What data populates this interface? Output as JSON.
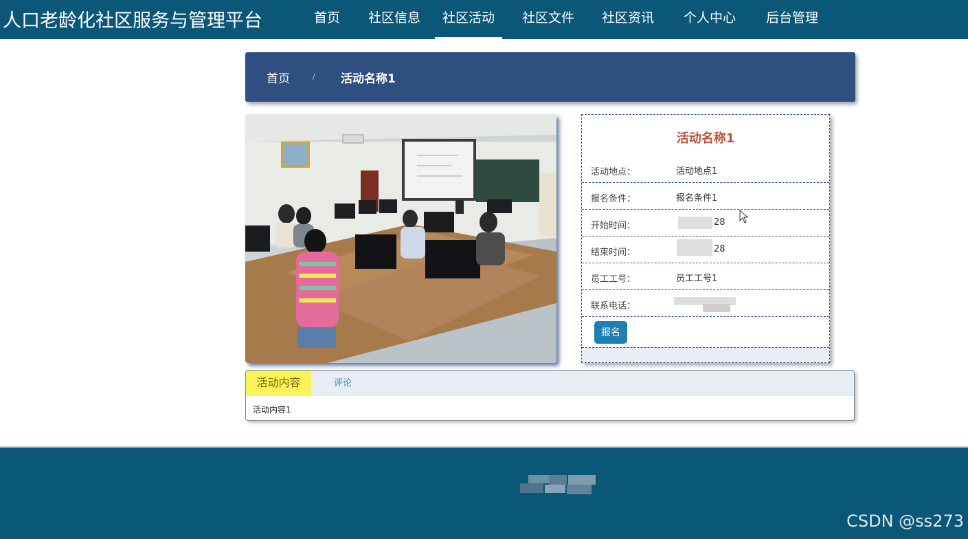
{
  "header": {
    "site_title": "人口老龄化社区服务与管理平台",
    "nav": [
      {
        "label": "首页"
      },
      {
        "label": "社区信息"
      },
      {
        "label": "社区活动"
      },
      {
        "label": "社区文件"
      },
      {
        "label": "社区资讯"
      },
      {
        "label": "个人中心"
      },
      {
        "label": "后台管理"
      }
    ],
    "active_nav": "社区活动"
  },
  "breadcrumb": {
    "home": "首页",
    "separator": "/",
    "current": "活动名称1"
  },
  "activity": {
    "title": "活动名称1",
    "fields": [
      {
        "label": "活动地点：",
        "value": "活动地点1"
      },
      {
        "label": "报名条件：",
        "value": "报名条件1"
      },
      {
        "label": "开始时间：",
        "value": "28"
      },
      {
        "label": "结束时间：",
        "value": "28"
      },
      {
        "label": "员工工号：",
        "value": "员工工号1"
      },
      {
        "label": "联系电话：",
        "value": ""
      }
    ],
    "signup_label": "报名"
  },
  "tabs": {
    "active": "活动内容",
    "other": "评论",
    "content": "活动内容1"
  },
  "footer": {
    "watermark": "CSDN @ss273"
  },
  "colors": {
    "primary": "#0b5778",
    "breadcrumb_bg": "#2e4f7f",
    "title_accent": "#b5553d",
    "button": "#1f7eb3",
    "tab_active": "#f8f55b"
  }
}
